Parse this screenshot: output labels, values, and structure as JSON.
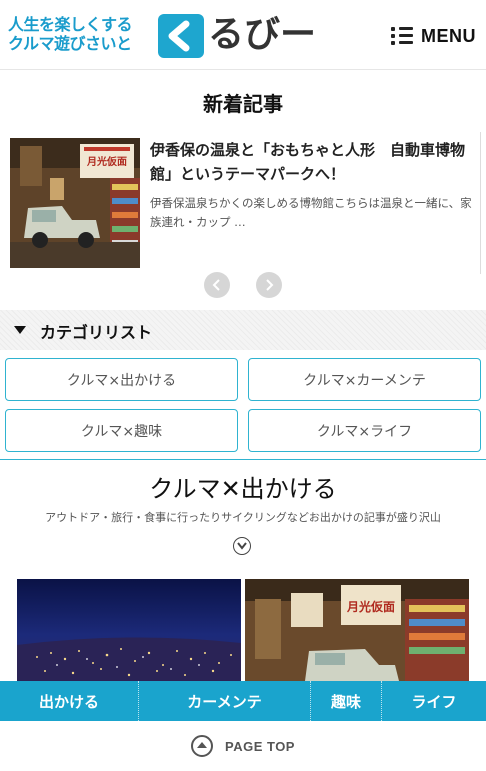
{
  "header": {
    "tagline_line1": "人生を楽しくする",
    "tagline_line2": "クルマ遊びさいと",
    "logo_text": "るびー",
    "menu_label": "MENU",
    "brand_color": "#1ea6cf"
  },
  "new_articles": {
    "title": "新着記事",
    "slide": {
      "title": "伊香保の温泉と「おもちゃと人形　自動車博物館」というテーマパークへ！",
      "excerpt": "伊香保温泉ちかくの楽しめる博物館こちらは温泉と一緒に、家族連れ・カップ …",
      "thumb_sign": "月光仮面"
    },
    "prev_icon": "chevron-left-icon",
    "next_icon": "chevron-right-icon"
  },
  "categories": {
    "title": "カテゴリリスト",
    "items": [
      "クルマ×出かける",
      "クルマ×カーメンテ",
      "クルマ×趣味",
      "クルマ×ライフ"
    ]
  },
  "featured": {
    "title": "クルマ✕出かける",
    "description": "アウトドア・旅行・食事に行ったりサイクリングなどお出かけの記事が盛り沢山",
    "card2_sign": "月光仮面"
  },
  "bottom_nav": {
    "items": [
      "出かける",
      "カーメンテ",
      "趣味",
      "ライフ"
    ],
    "color": "#1aa4cd"
  },
  "page_top": {
    "label": "PAGE TOP"
  }
}
